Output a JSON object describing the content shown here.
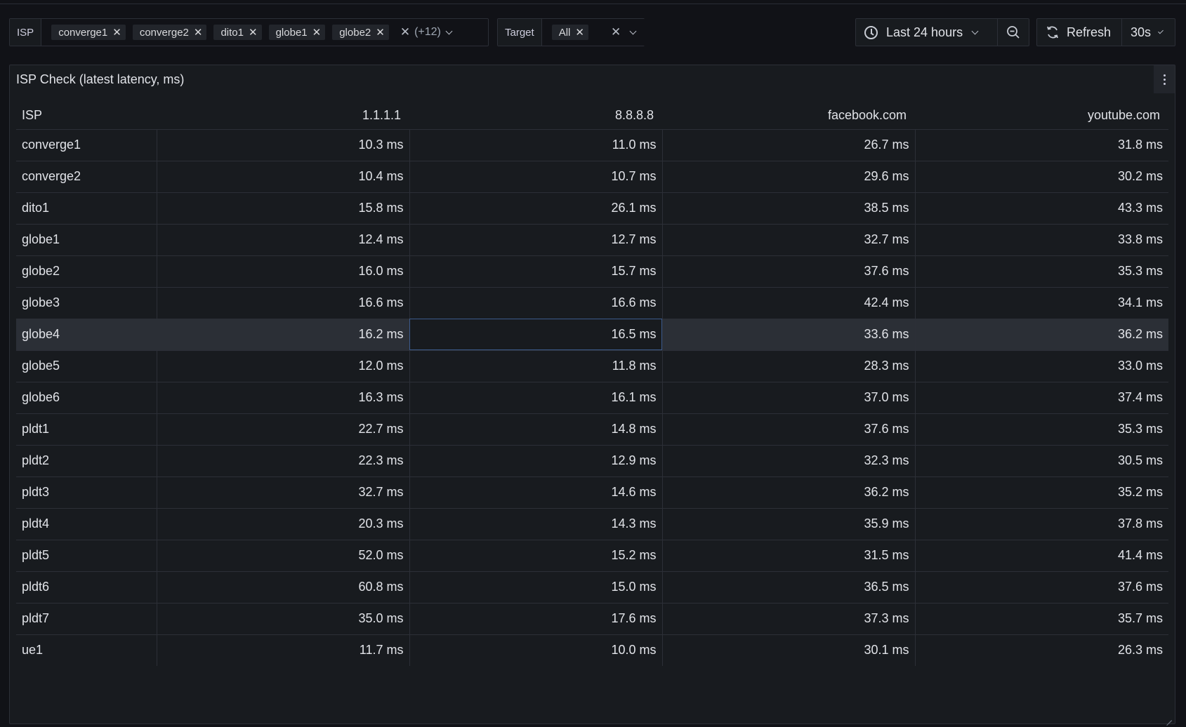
{
  "variables": {
    "isp": {
      "label": "ISP",
      "chips": [
        "converge1",
        "converge2",
        "dito1",
        "globe1",
        "globe2"
      ],
      "more": "(+12)"
    },
    "target": {
      "label": "Target",
      "chips": [
        "All"
      ]
    }
  },
  "time_picker": {
    "label": "Last 24 hours"
  },
  "refresh": {
    "label": "Refresh",
    "interval": "30s"
  },
  "panel": {
    "title": "ISP Check (latest latency, ms)",
    "columns": [
      "ISP",
      "1.1.1.1",
      "8.8.8.8",
      "facebook.com",
      "youtube.com"
    ],
    "highlighted_row": "globe4",
    "rows": [
      [
        "converge1",
        "10.3 ms",
        "11.0 ms",
        "26.7 ms",
        "31.8 ms"
      ],
      [
        "converge2",
        "10.4 ms",
        "10.7 ms",
        "29.6 ms",
        "30.2 ms"
      ],
      [
        "dito1",
        "15.8 ms",
        "26.1 ms",
        "38.5 ms",
        "43.3 ms"
      ],
      [
        "globe1",
        "12.4 ms",
        "12.7 ms",
        "32.7 ms",
        "33.8 ms"
      ],
      [
        "globe2",
        "16.0 ms",
        "15.7 ms",
        "37.6 ms",
        "35.3 ms"
      ],
      [
        "globe3",
        "16.6 ms",
        "16.6 ms",
        "42.4 ms",
        "34.1 ms"
      ],
      [
        "globe4",
        "16.2 ms",
        "16.5 ms",
        "33.6 ms",
        "36.2 ms"
      ],
      [
        "globe5",
        "12.0 ms",
        "11.8 ms",
        "28.3 ms",
        "33.0 ms"
      ],
      [
        "globe6",
        "16.3 ms",
        "16.1 ms",
        "37.0 ms",
        "37.4 ms"
      ],
      [
        "pldt1",
        "22.7 ms",
        "14.8 ms",
        "37.6 ms",
        "35.3 ms"
      ],
      [
        "pldt2",
        "22.3 ms",
        "12.9 ms",
        "32.3 ms",
        "30.5 ms"
      ],
      [
        "pldt3",
        "32.7 ms",
        "14.6 ms",
        "36.2 ms",
        "35.2 ms"
      ],
      [
        "pldt4",
        "20.3 ms",
        "14.3 ms",
        "35.9 ms",
        "37.8 ms"
      ],
      [
        "pldt5",
        "52.0 ms",
        "15.2 ms",
        "31.5 ms",
        "41.4 ms"
      ],
      [
        "pldt6",
        "60.8 ms",
        "15.0 ms",
        "36.5 ms",
        "37.6 ms"
      ],
      [
        "pldt7",
        "35.0 ms",
        "17.6 ms",
        "37.3 ms",
        "35.7 ms"
      ],
      [
        "ue1",
        "11.7 ms",
        "10.0 ms",
        "30.1 ms",
        "26.3 ms"
      ]
    ]
  }
}
